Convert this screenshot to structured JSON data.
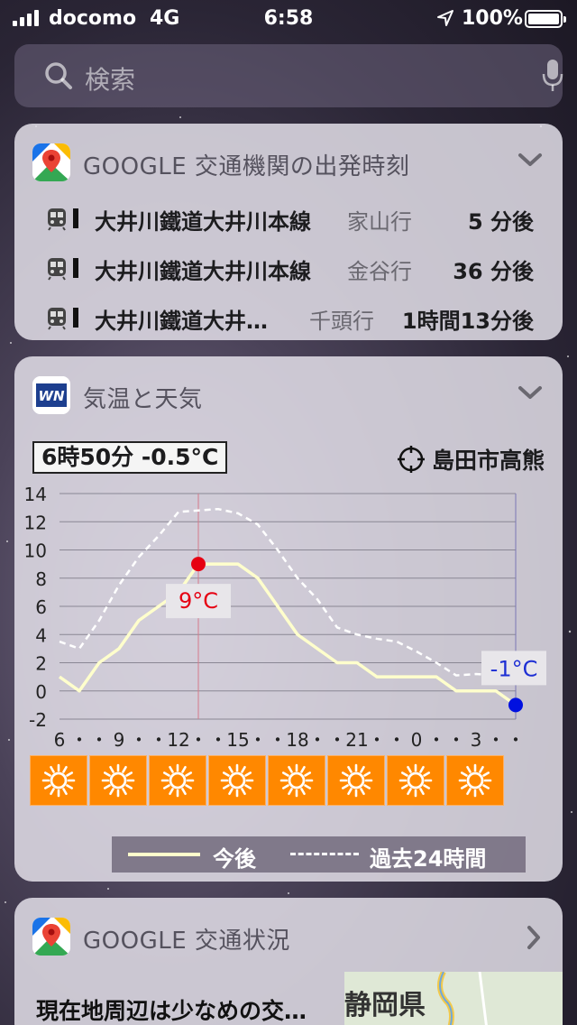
{
  "status_bar": {
    "carrier": "docomo",
    "network": "4G",
    "time": "6:58",
    "battery": "100%"
  },
  "search": {
    "placeholder": "検索"
  },
  "transit_widget": {
    "title": "GOOGLE 交通機関の出発時刻",
    "departures": [
      {
        "line": "大井川鐵道大井川本線",
        "destination": "家山行",
        "eta": "5 分後"
      },
      {
        "line": "大井川鐵道大井川本線",
        "destination": "金谷行",
        "eta": "36 分後"
      },
      {
        "line": "大井川鐵道大井…",
        "destination": "千頭行",
        "eta": "1時間13分後"
      }
    ]
  },
  "weather_widget": {
    "title": "気温と天気",
    "current_readout": "6時50分 -0.5°C",
    "location": "島田市高熊",
    "max_label": "9°C",
    "min_label": "-1°C",
    "legend_future": "今後",
    "legend_past": "過去24時間",
    "weather_icons": [
      "sun-icon",
      "sun-icon",
      "sun-icon",
      "sun-icon",
      "sun-icon",
      "sun-icon",
      "sun-icon",
      "sun-icon"
    ]
  },
  "traffic_widget": {
    "title": "GOOGLE 交通状況",
    "summary": "現在地周辺は少なめの交…",
    "map_label": "静岡県"
  },
  "chart_data": {
    "type": "line",
    "yticks": [
      "14",
      "12",
      "10",
      "8",
      "6",
      "4",
      "2",
      "0",
      "-2"
    ],
    "ylim": [
      -2,
      14
    ],
    "xticks": [
      "6",
      "・",
      "・",
      "9",
      "・",
      "・",
      "12",
      "・",
      "・",
      "15",
      "・",
      "・",
      "18",
      "・",
      "・",
      "21",
      "・",
      "・",
      "0",
      "・",
      "・",
      "3",
      "・",
      "・"
    ],
    "x_hours": [
      6,
      7,
      8,
      9,
      10,
      11,
      12,
      13,
      14,
      15,
      16,
      17,
      18,
      19,
      20,
      21,
      22,
      23,
      24,
      25,
      26,
      27,
      28,
      29
    ],
    "series": [
      {
        "name": "今後",
        "style": "solid",
        "color": "#ffffcc",
        "values": [
          1,
          0,
          2,
          3,
          5,
          6,
          7,
          9,
          9,
          9,
          8,
          6,
          4,
          3,
          2,
          2,
          1,
          1,
          1,
          1,
          0,
          0,
          0,
          -1
        ]
      },
      {
        "name": "過去24時間",
        "style": "dashed",
        "color": "#ffffff",
        "values": [
          3.5,
          3,
          5,
          7.5,
          9.5,
          11,
          12.7,
          12.8,
          12.9,
          12.6,
          11.8,
          10,
          8,
          6.5,
          4.5,
          4,
          3.7,
          3.5,
          2.8,
          2,
          1.1,
          1.2,
          1.1,
          0.5
        ]
      }
    ],
    "max_point": {
      "hour": 13,
      "value": 9
    },
    "min_point": {
      "hour": 29,
      "value": -1
    }
  }
}
